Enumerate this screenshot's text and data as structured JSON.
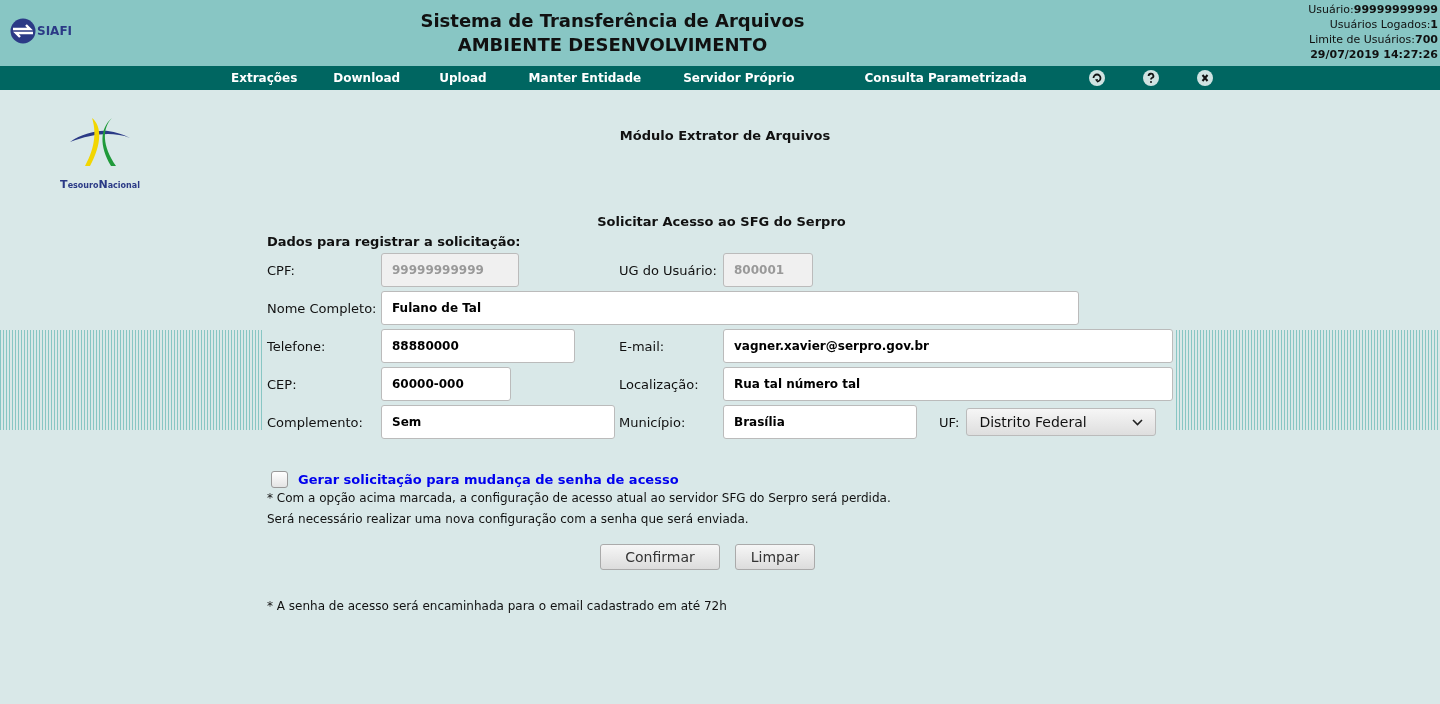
{
  "header": {
    "logo_text": "SIAFI",
    "title": "Sistema de Transferência de Arquivos",
    "subtitle": "AMBIENTE DESENVOLVIMENTO",
    "info": [
      {
        "label": "Usuário:",
        "value": "99999999999"
      },
      {
        "label": "Usuários Logados:",
        "value": "1"
      },
      {
        "label": "Limite de Usuários:",
        "value": "700"
      }
    ],
    "datetime": "29/07/2019 14:27:26"
  },
  "nav": {
    "items": [
      "Extrações",
      "Download",
      "Upload",
      "Manter Entidade",
      "Servidor Próprio",
      "Consulta Parametrizada"
    ],
    "icons": [
      {
        "kind": "refresh"
      },
      {
        "kind": "help"
      },
      {
        "kind": "close"
      }
    ]
  },
  "brand": {
    "text_parts": [
      "Tesouro",
      "Nacional"
    ]
  },
  "module_title": "Módulo Extrator de Arquivos",
  "form": {
    "title": "Solicitar Acesso ao SFG do Serpro",
    "section": "Dados para registrar a solicitação:",
    "rows": [
      [
        {
          "label": "CPF:",
          "value": "99999999999",
          "disabled": true
        },
        {
          "label": "UG do Usuário:",
          "value": "800001",
          "disabled": true
        }
      ],
      [
        {
          "label": "Nome Completo:",
          "value": "Fulano de Tal",
          "disabled": false
        }
      ],
      [
        {
          "label": "Telefone:",
          "value": "88880000",
          "disabled": false
        },
        {
          "label": "E-mail:",
          "value": "vagner.xavier@serpro.gov.br",
          "disabled": false
        }
      ],
      [
        {
          "label": "CEP:",
          "value": "60000-000",
          "disabled": false
        },
        {
          "label": "Localização:",
          "value": "Rua tal número tal",
          "disabled": false
        }
      ],
      [
        {
          "label": "Complemento:",
          "value": "Sem",
          "disabled": false
        },
        {
          "label": "Município:",
          "value": "Brasília",
          "disabled": false
        }
      ]
    ],
    "uf": {
      "label": "UF:",
      "value": "Distrito Federal"
    },
    "checkbox": {
      "label": "Gerar solicitação para mudança de senha de acesso",
      "checked": false
    },
    "notes": [
      "* Com a opção acima marcada, a configuração de acesso atual ao servidor SFG do Serpro será perdida.",
      "Será necessário realizar uma nova configuração com a senha que será enviada."
    ],
    "buttons": [
      "Confirmar",
      "Limpar"
    ],
    "footnote": "* A senha de acesso será encaminhada para o email cadastrado em até 72h"
  }
}
